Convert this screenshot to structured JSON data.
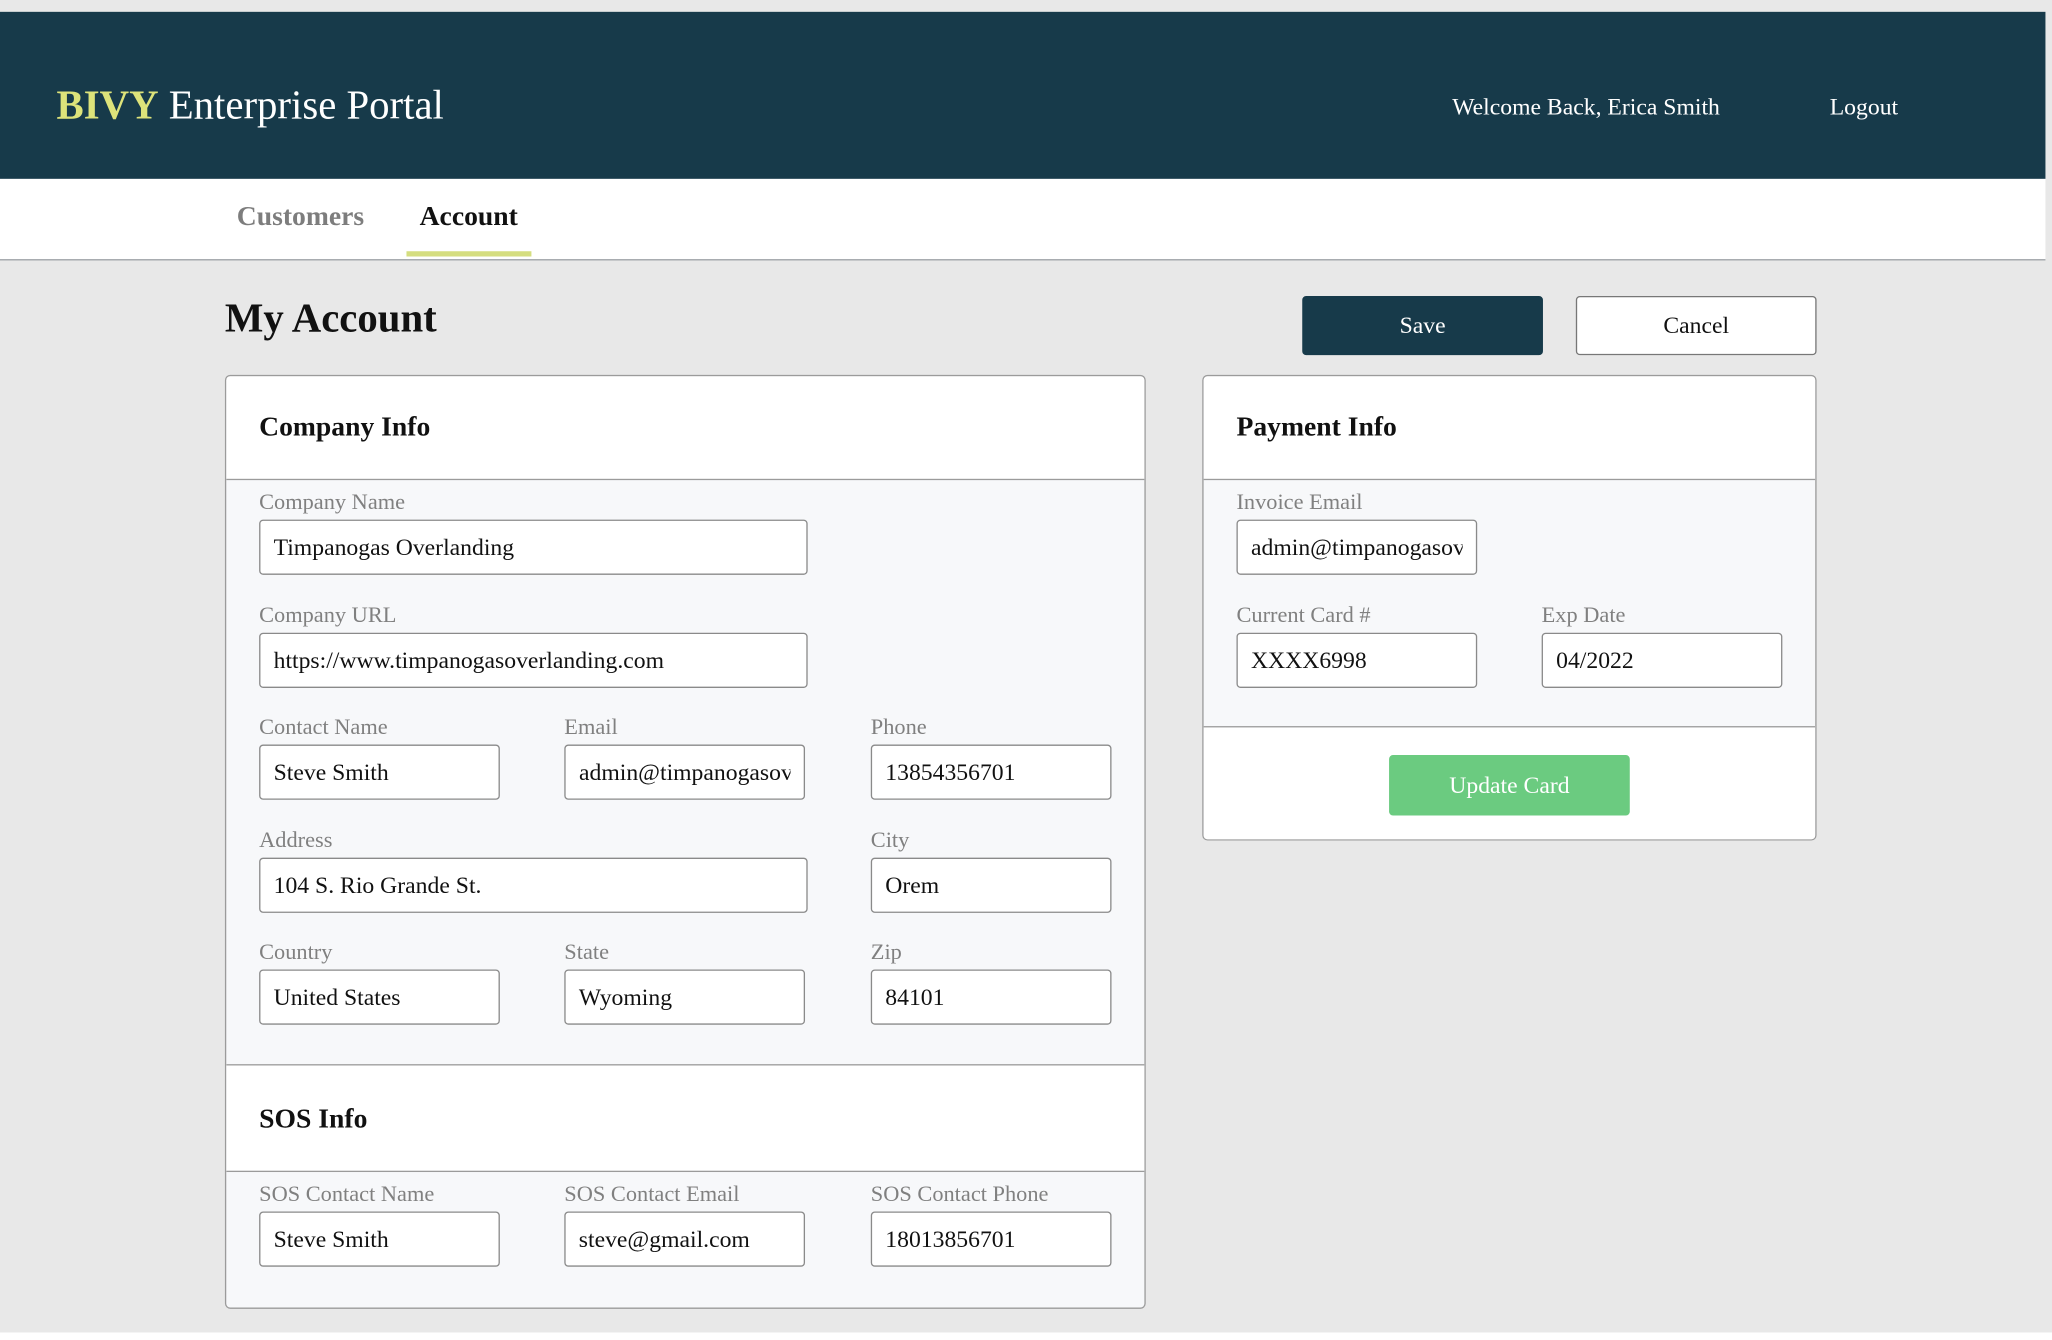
{
  "header": {
    "brand_bold": "BIVY",
    "brand_rest": "Enterprise Portal",
    "welcome": "Welcome Back, Erica Smith",
    "logout": "Logout"
  },
  "nav": {
    "tabs": [
      {
        "label": "Customers",
        "active": false
      },
      {
        "label": "Account",
        "active": true
      }
    ]
  },
  "page": {
    "title": "My Account",
    "save_label": "Save",
    "cancel_label": "Cancel"
  },
  "company": {
    "title": "Company Info",
    "company_name": {
      "label": "Company Name",
      "value": "Timpanogas Overlanding"
    },
    "company_url": {
      "label": "Company URL",
      "value": "https://www.timpanogasoverlanding.com"
    },
    "contact_name": {
      "label": "Contact Name",
      "value": "Steve Smith"
    },
    "email": {
      "label": "Email",
      "value": "admin@timpanogasoverlanding.com"
    },
    "phone": {
      "label": "Phone",
      "value": "13854356701"
    },
    "address": {
      "label": "Address",
      "value": "104 S. Rio Grande St."
    },
    "city": {
      "label": "City",
      "value": "Orem"
    },
    "country": {
      "label": "Country",
      "value": "United States"
    },
    "state": {
      "label": "State",
      "value": "Wyoming"
    },
    "zip": {
      "label": "Zip",
      "value": "84101"
    }
  },
  "sos": {
    "title": "SOS Info",
    "contact_name": {
      "label": "SOS Contact Name",
      "value": "Steve Smith"
    },
    "contact_email": {
      "label": "SOS Contact Email",
      "value": "steve@gmail.com"
    },
    "contact_phone": {
      "label": "SOS Contact Phone",
      "value": "18013856701"
    }
  },
  "payment": {
    "title": "Payment Info",
    "invoice_email": {
      "label": "Invoice Email",
      "value": "admin@timpanogasoverlanding.com"
    },
    "card": {
      "label": "Current Card #",
      "value": "XXXX6998"
    },
    "exp": {
      "label": "Exp Date",
      "value": "04/2022"
    },
    "update_label": "Update Card"
  },
  "colors": {
    "header_bg": "#173a4a",
    "brand_accent": "#dde37a",
    "tab_underline": "#d5de80",
    "update_button": "#6bcb80",
    "page_bg": "#e8e8e8"
  }
}
